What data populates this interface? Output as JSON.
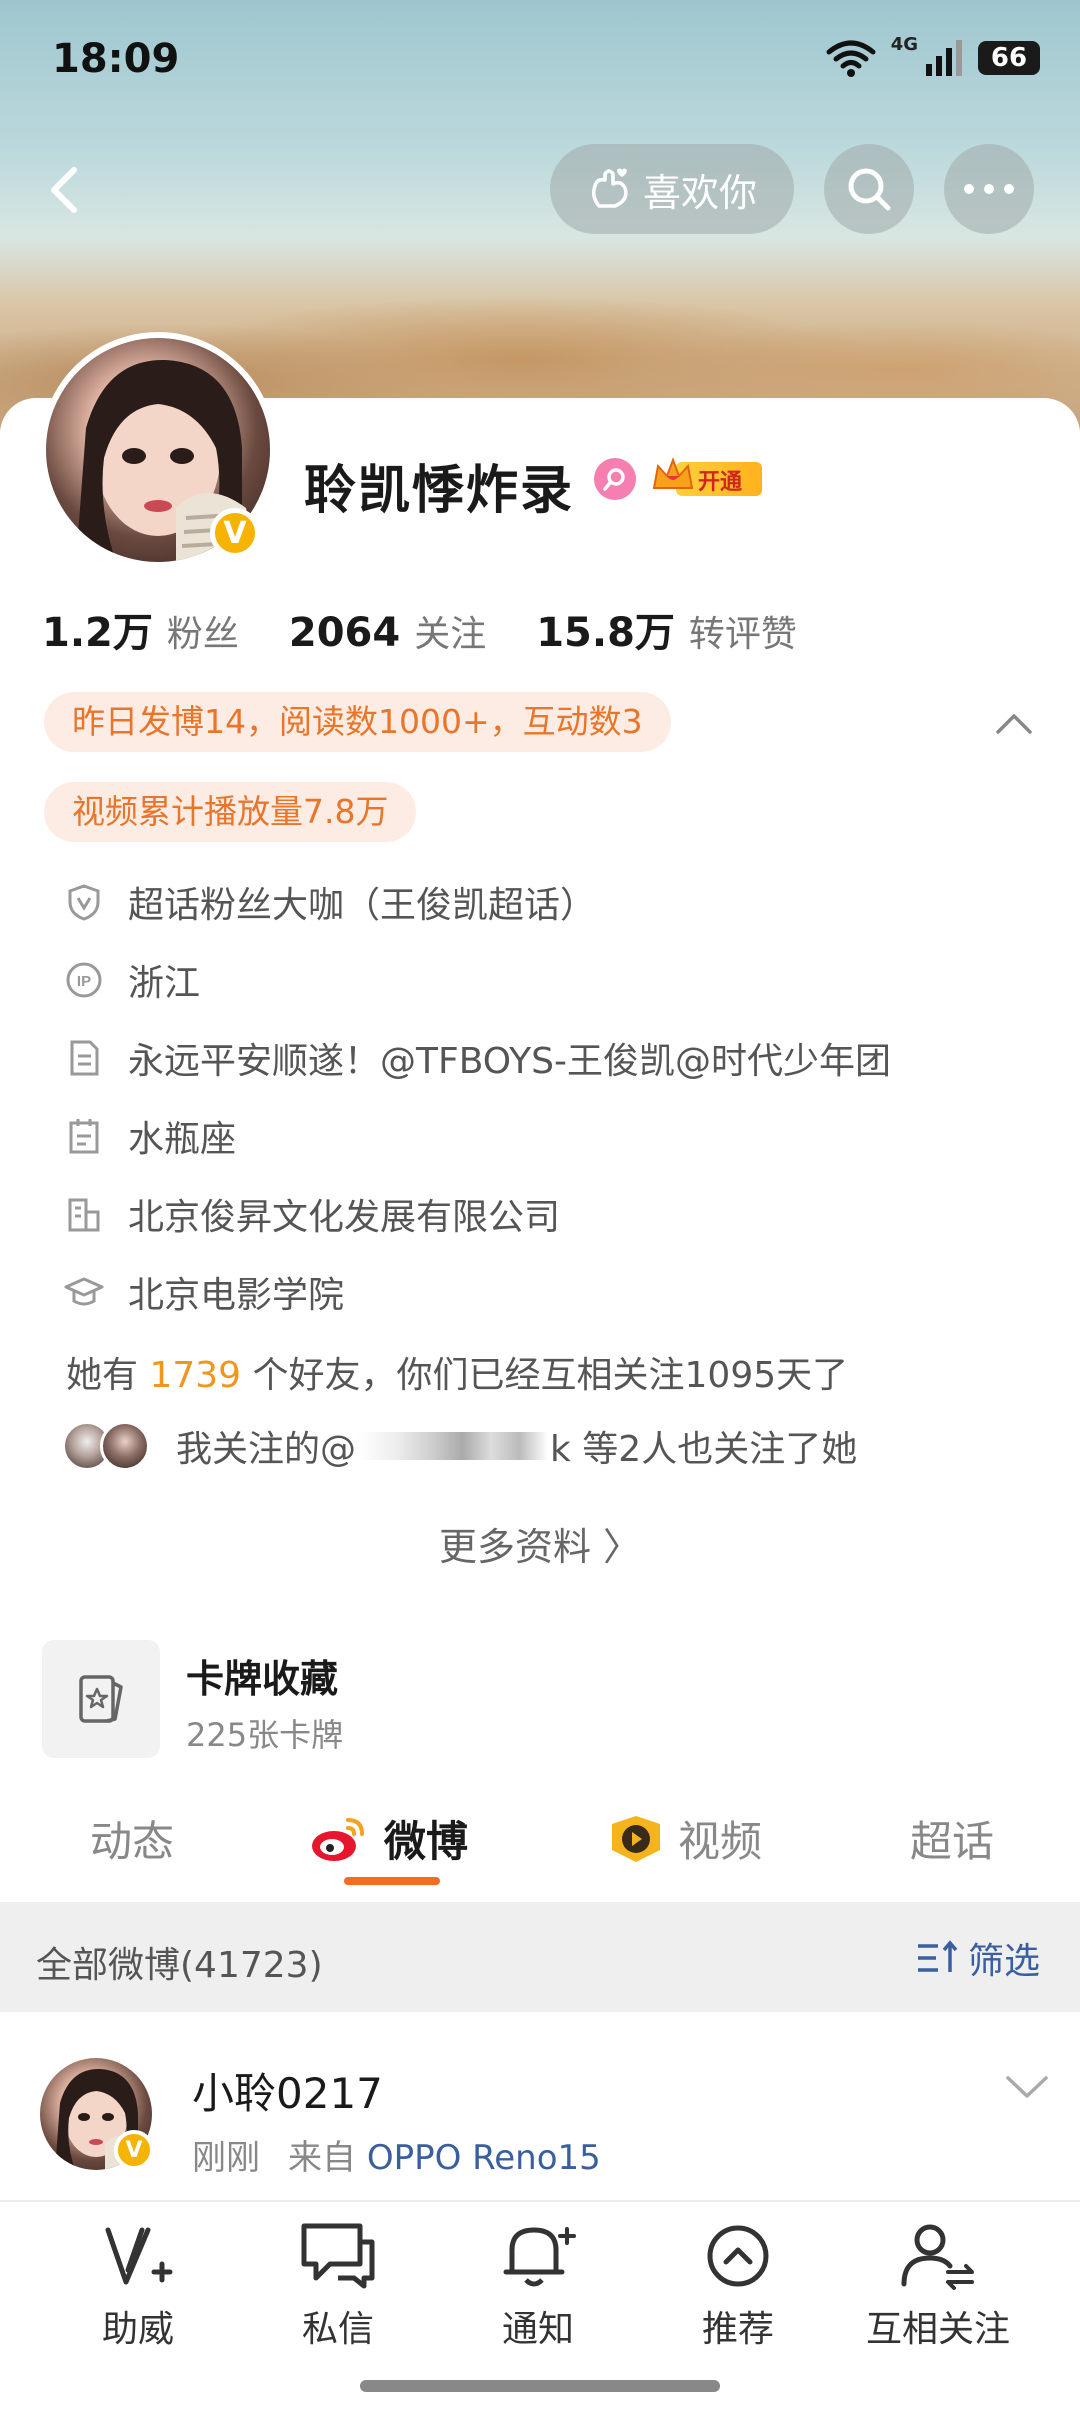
{
  "status_bar": {
    "time": "18:09",
    "network": "4G",
    "battery": "66"
  },
  "header": {
    "like_label": "喜欢你"
  },
  "profile": {
    "name": "聆凯悸炸录",
    "vip_label": "开通",
    "stats": [
      {
        "value": "1.2万",
        "label": "粉丝"
      },
      {
        "value": "2064",
        "label": "关注"
      },
      {
        "value": "15.8万",
        "label": "转评赞"
      }
    ],
    "activity_pills": [
      "昨日发博14，阅读数1000+，互动数3",
      "视频累计播放量7.8万"
    ],
    "info_rows": [
      {
        "icon": "shield-v-icon",
        "text": "超话粉丝大咖（王俊凯超话）"
      },
      {
        "icon": "ip-icon",
        "text": "浙江"
      },
      {
        "icon": "document-icon",
        "text": "永远平安顺遂！@TFBOYS-王俊凯@时代少年团"
      },
      {
        "icon": "calendar-icon",
        "text": "水瓶座"
      },
      {
        "icon": "building-icon",
        "text": "北京俊昇文化发展有限公司"
      },
      {
        "icon": "graduation-cap-icon",
        "text": "北京电影学院"
      }
    ],
    "friends": {
      "prefix": "她有 ",
      "count": "1739",
      "suffix": " 个好友，你们已经互相关注1095天了"
    },
    "mutual_follow": {
      "prefix": "我关注的@",
      "suffix": "k 等2人也关注了她"
    },
    "more_label": "更多资料 〉"
  },
  "card_collection": {
    "title": "卡牌收藏",
    "subtitle": "225张卡牌"
  },
  "tabs": [
    {
      "label": "动态",
      "icon": ""
    },
    {
      "label": "微博",
      "icon": "weibo-icon"
    },
    {
      "label": "视频",
      "icon": "video-icon"
    },
    {
      "label": "超话",
      "icon": ""
    }
  ],
  "filter_bar": {
    "title": "全部微博(41723)",
    "filter_label": "筛选"
  },
  "post": {
    "author": "小聆0217",
    "time": "刚刚",
    "from_prefix": "来自 ",
    "device": "OPPO Reno15"
  },
  "bottom_nav": [
    {
      "label": "助威",
      "icon": "cheer-icon"
    },
    {
      "label": "私信",
      "icon": "message-icon"
    },
    {
      "label": "通知",
      "icon": "bell-icon"
    },
    {
      "label": "推荐",
      "icon": "recommend-icon"
    },
    {
      "label": "互相关注",
      "icon": "mutual-follow-icon"
    }
  ],
  "colors": {
    "accent": "#f26d22",
    "highlight": "#f0961e",
    "link": "#3a5fa0",
    "verified": "#f6b400"
  }
}
